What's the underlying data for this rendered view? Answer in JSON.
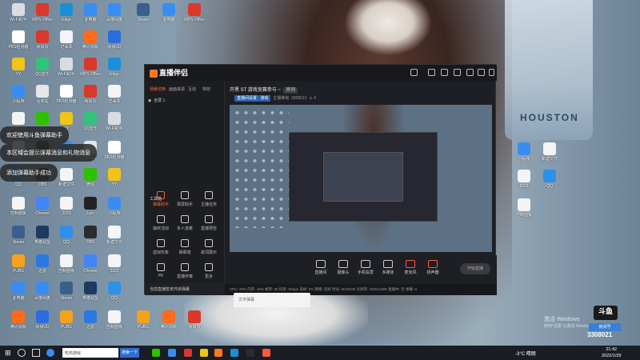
{
  "desktop": {
    "icons": [
      {
        "label": "Wi-Fi助手",
        "color": "#d9dde2"
      },
      {
        "label": "PKS检测器",
        "color": "#ffffff"
      },
      {
        "label": "YY",
        "color": "#f0c419"
      },
      {
        "label": "小程序",
        "color": "#3a8df0"
      },
      {
        "label": "新建文件",
        "color": "#f4f4f4"
      },
      {
        "label": "2023",
        "color": "#f4f4f4"
      },
      {
        "label": "QQ",
        "color": "#2e90e8"
      },
      {
        "label": "控制面板",
        "color": "#f4f4f4"
      },
      {
        "label": "Steam",
        "color": "#3a5f8a"
      },
      {
        "label": "PUBG",
        "color": "#f4a11c"
      },
      {
        "label": "此电脑",
        "color": "#3a8df0"
      },
      {
        "label": "腾讯视频",
        "color": "#ff6b1a"
      },
      {
        "label": "WPS Office",
        "color": "#d9382b"
      },
      {
        "label": "网易云",
        "color": "#d9382b"
      },
      {
        "label": "QQ音乐",
        "color": "#31c27c"
      },
      {
        "label": "回收站",
        "color": "#e6e6e6"
      },
      {
        "label": "微信",
        "color": "#2dc100"
      },
      {
        "label": "Epic",
        "color": "#222222"
      },
      {
        "label": "OBS",
        "color": "#2c2c2c"
      },
      {
        "label": "Chrome",
        "color": "#4285f4"
      },
      {
        "label": "英雄联盟",
        "color": "#1d3a5f"
      },
      {
        "label": "迅雷",
        "color": "#2b79e0"
      },
      {
        "label": "百度网盘",
        "color": "#3a8df0"
      },
      {
        "label": "网易UU",
        "color": "#2d6cdf"
      },
      {
        "label": "Edge",
        "color": "#1b8fd6"
      },
      {
        "label": "记事本",
        "color": "#f4f4f4"
      }
    ],
    "banner_text": "HOUSTON",
    "notifications": [
      "欢迎使用斗鱼弹幕助手",
      "本区域会提示弹幕消息和礼物消息",
      "添加弹幕助手成功"
    ],
    "activate_windows": {
      "title": "激活 Windows",
      "sub": "转到\"设置\"以激活 Windows。"
    },
    "watermark": {
      "logo": "斗鱼",
      "label": "房间号",
      "room": "3308021"
    }
  },
  "app": {
    "logo": "直播伴侣",
    "sidebar_tabs": [
      "场景切换",
      "画面来源",
      "互动",
      "特效"
    ],
    "scene": "全屏 1",
    "tools_title": "工具箱",
    "tools": [
      "弹幕助手",
      "录屏助手",
      "主播任务",
      "抽奖活动",
      "多人连麦",
      "直播预告",
      "虚拟形象",
      "弹幕墙",
      "歌词展示",
      "PK",
      "直播伴奏",
      "更多"
    ],
    "warning": "当前直播暂未开启弹幕",
    "room_title": "开黑 ST 游戏竞赛参与 ~",
    "room_tag": "房间",
    "room_sub_items": [
      "直播间设置 · 游戏",
      "主播等级",
      "3308021"
    ],
    "room_count": "4",
    "controls": [
      "直播间",
      "摄像头",
      "手机投屏",
      "多媒体",
      "麦克风",
      "扬声器"
    ],
    "go_live": "开始直播",
    "status": "CPU: 20%   内存: 42%   帧率: 30   码率: 0Kbps   丢帧: 0%   网络: 良好   时长: 00:00:00   分辨率: 1920x1080   直播中: 否   弹幕: 0",
    "chat_placeholder": "文字弹幕"
  },
  "taskbar": {
    "search_text": "吃鸡游戏",
    "search_button": "搜索一下",
    "temp": "-3°C  晴朗",
    "time": "21:42",
    "date": "2022/1/29"
  }
}
